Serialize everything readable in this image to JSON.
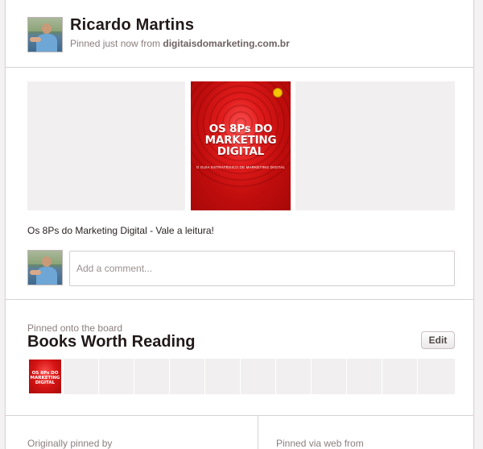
{
  "pin": {
    "pinner_name": "Ricardo Martins",
    "source_prefix": "Pinned just now from ",
    "source_domain": "digitaisdomarketing.com.br",
    "book_cover": {
      "title_line1": "OS 8Ps DO",
      "title_line2": "MARKETING",
      "title_line3": "DIGITAL",
      "subtitle": "O GUIA ESTRATÉGICO DE MARKETING DIGITAL",
      "background_color": "#d51414"
    },
    "description": "Os 8Ps do Marketing Digital - Vale a leitura!"
  },
  "comment": {
    "placeholder": "Add a comment..."
  },
  "board": {
    "caption": "Pinned onto the board",
    "name": "Books Worth Reading",
    "edit_label": "Edit",
    "thumb_mini_title": "OS 8Ps DO MARKETING DIGITAL"
  },
  "footer": {
    "originally_pinned_label": "Originally pinned by",
    "pinned_via_label": "Pinned via web from"
  },
  "colors": {
    "page_bg": "#f4f2f2",
    "card_bg": "#ffffff",
    "muted_text": "#8c7e7e",
    "dark_text": "#221919",
    "placeholder_tile": "#f1efef",
    "book_red": "#d51414"
  }
}
